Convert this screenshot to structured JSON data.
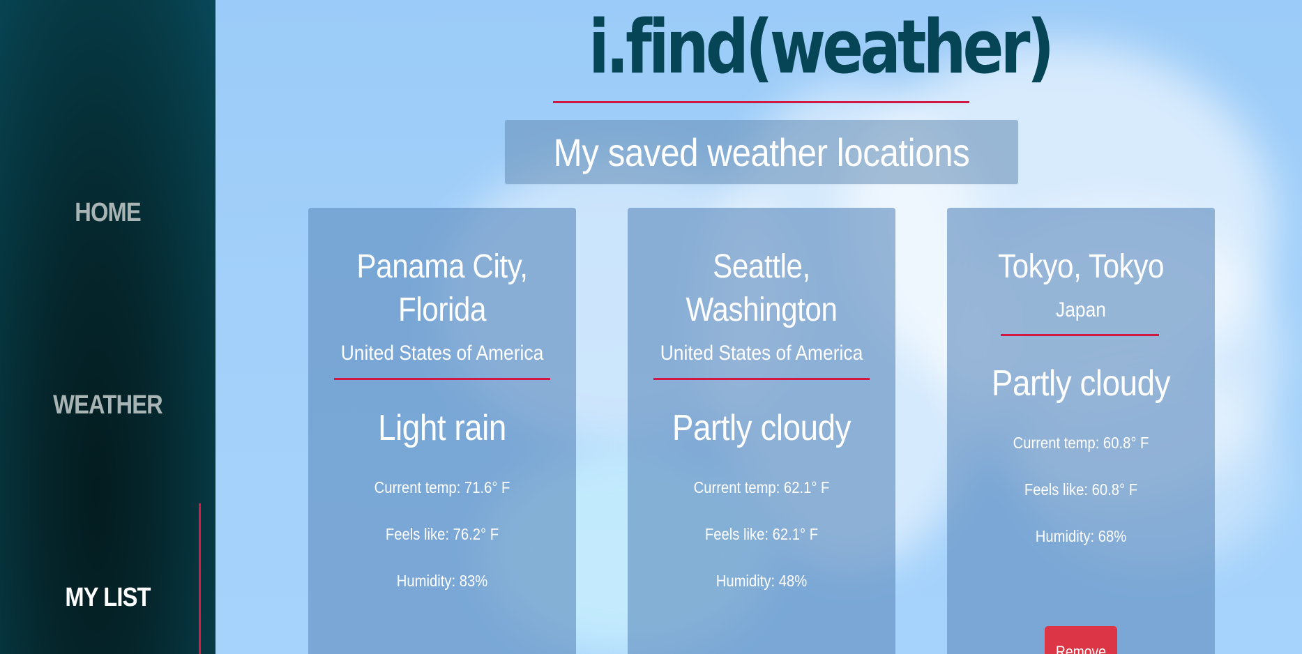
{
  "nav": {
    "home_label": "HOME",
    "weather_label": "WEATHER",
    "mylist_label": "MY LIST"
  },
  "header": {
    "title": "i.find(weather)",
    "subtitle": "My saved weather locations"
  },
  "locations": [
    {
      "city": "Panama City, Florida",
      "country": "United States of America",
      "condition": "Light rain",
      "current_temp": "Current temp: 71.6° F",
      "feels_like": "Feels like: 76.2° F",
      "humidity": "Humidity: 83%"
    },
    {
      "city": "Seattle, Washington",
      "country": "United States of America",
      "condition": "Partly cloudy",
      "current_temp": "Current temp: 62.1° F",
      "feels_like": "Feels like: 62.1° F",
      "humidity": "Humidity: 48%"
    },
    {
      "city": "Tokyo, Tokyo",
      "country": "Japan",
      "condition": "Partly cloudy",
      "current_temp": "Current temp: 60.8° F",
      "feels_like": "Feels like: 60.8° F",
      "humidity": "Humidity: 68%",
      "remove_label": "Remove"
    }
  ],
  "colors": {
    "accent": "#d11744",
    "title": "#064555",
    "remove_button": "#dc3545",
    "sidebar": "#05262c"
  }
}
